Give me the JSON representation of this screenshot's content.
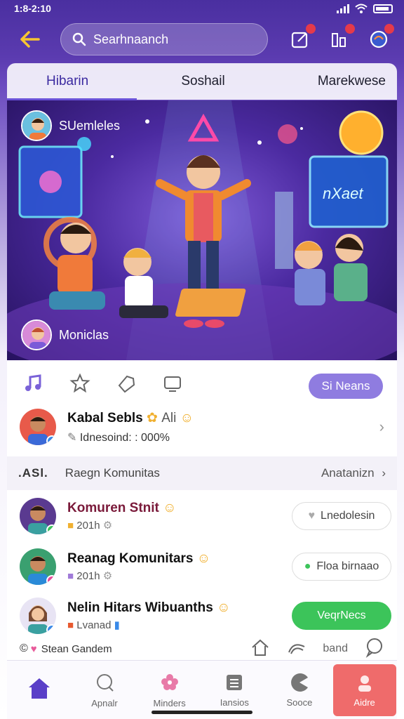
{
  "status_bar": {
    "time": "1:8-2:10"
  },
  "search": {
    "placeholder": "Searhnaanch"
  },
  "tabs": [
    {
      "label": "Hibarin",
      "active": true
    },
    {
      "label": "Soshail",
      "active": false
    },
    {
      "label": "Marekwese",
      "active": false
    }
  ],
  "hero": {
    "top_user": "SUemleles",
    "bottom_user": "Moniclas",
    "sign_text": "nXaet"
  },
  "card": {
    "news_button": "Si Neans",
    "feature": {
      "title": "Kabal Sebls",
      "title_suffix": "Ali",
      "subtitle": "Idnesoind: : 000%"
    },
    "section": {
      "lead": ".ASl.",
      "label": "Raegn Komunitas",
      "right": "Anatanizn"
    },
    "communities": [
      {
        "title": "Komuren Stnit",
        "meta": "201h",
        "action": "Lnedolesin",
        "action_style": "outline"
      },
      {
        "title": "Reanag Komunitars",
        "meta": "201h",
        "action": "Floa birnaao",
        "action_style": "outline"
      },
      {
        "title": "Nelin Hitars Wibuanths",
        "meta": "Lvanad",
        "action": "VeqrNecs",
        "action_style": "green"
      }
    ],
    "extra": {
      "label": "Stean Gandem",
      "right_label": "band"
    }
  },
  "bottom_nav": [
    {
      "label": "",
      "icon": "home-icon",
      "active": true
    },
    {
      "label": "Apnalr",
      "icon": "chat-icon",
      "active": false
    },
    {
      "label": "Minders",
      "icon": "flower-icon",
      "active": false
    },
    {
      "label": "Iansios",
      "icon": "list-icon",
      "active": false
    },
    {
      "label": "Sooce",
      "icon": "pacman-icon",
      "active": false
    },
    {
      "label": "Aidre",
      "icon": "profile-icon",
      "active": false,
      "alert": true
    }
  ],
  "colors": {
    "accent": "#6a52d8",
    "back_arrow": "#f7c531",
    "news_button": "#8f7ce0",
    "green_pill": "#3cc45a",
    "alert_nav": "#ef6b6b"
  }
}
